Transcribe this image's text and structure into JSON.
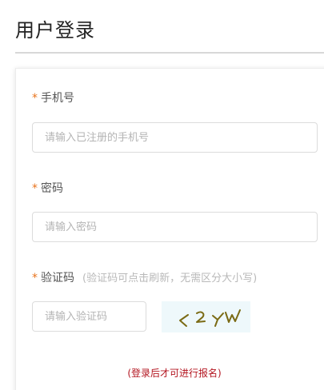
{
  "page": {
    "title": "用户登录"
  },
  "form": {
    "required_mark": "*",
    "phone": {
      "label": "手机号",
      "placeholder": "请输入已注册的手机号",
      "value": ""
    },
    "password": {
      "label": "密码",
      "placeholder": "请输入密码",
      "value": ""
    },
    "captcha": {
      "label": "验证码",
      "hint": "(验证码可点击刷新，无需区分大小写)",
      "placeholder": "请输入验证码",
      "value": "",
      "image_text": "< 2 Y W"
    },
    "note": "(登录后才可进行报名)"
  },
  "colors": {
    "required_mark": "#e8731c",
    "note": "#b3141f",
    "captcha_bg": "#eef8fb",
    "captcha_ink": "#7a6a14"
  }
}
